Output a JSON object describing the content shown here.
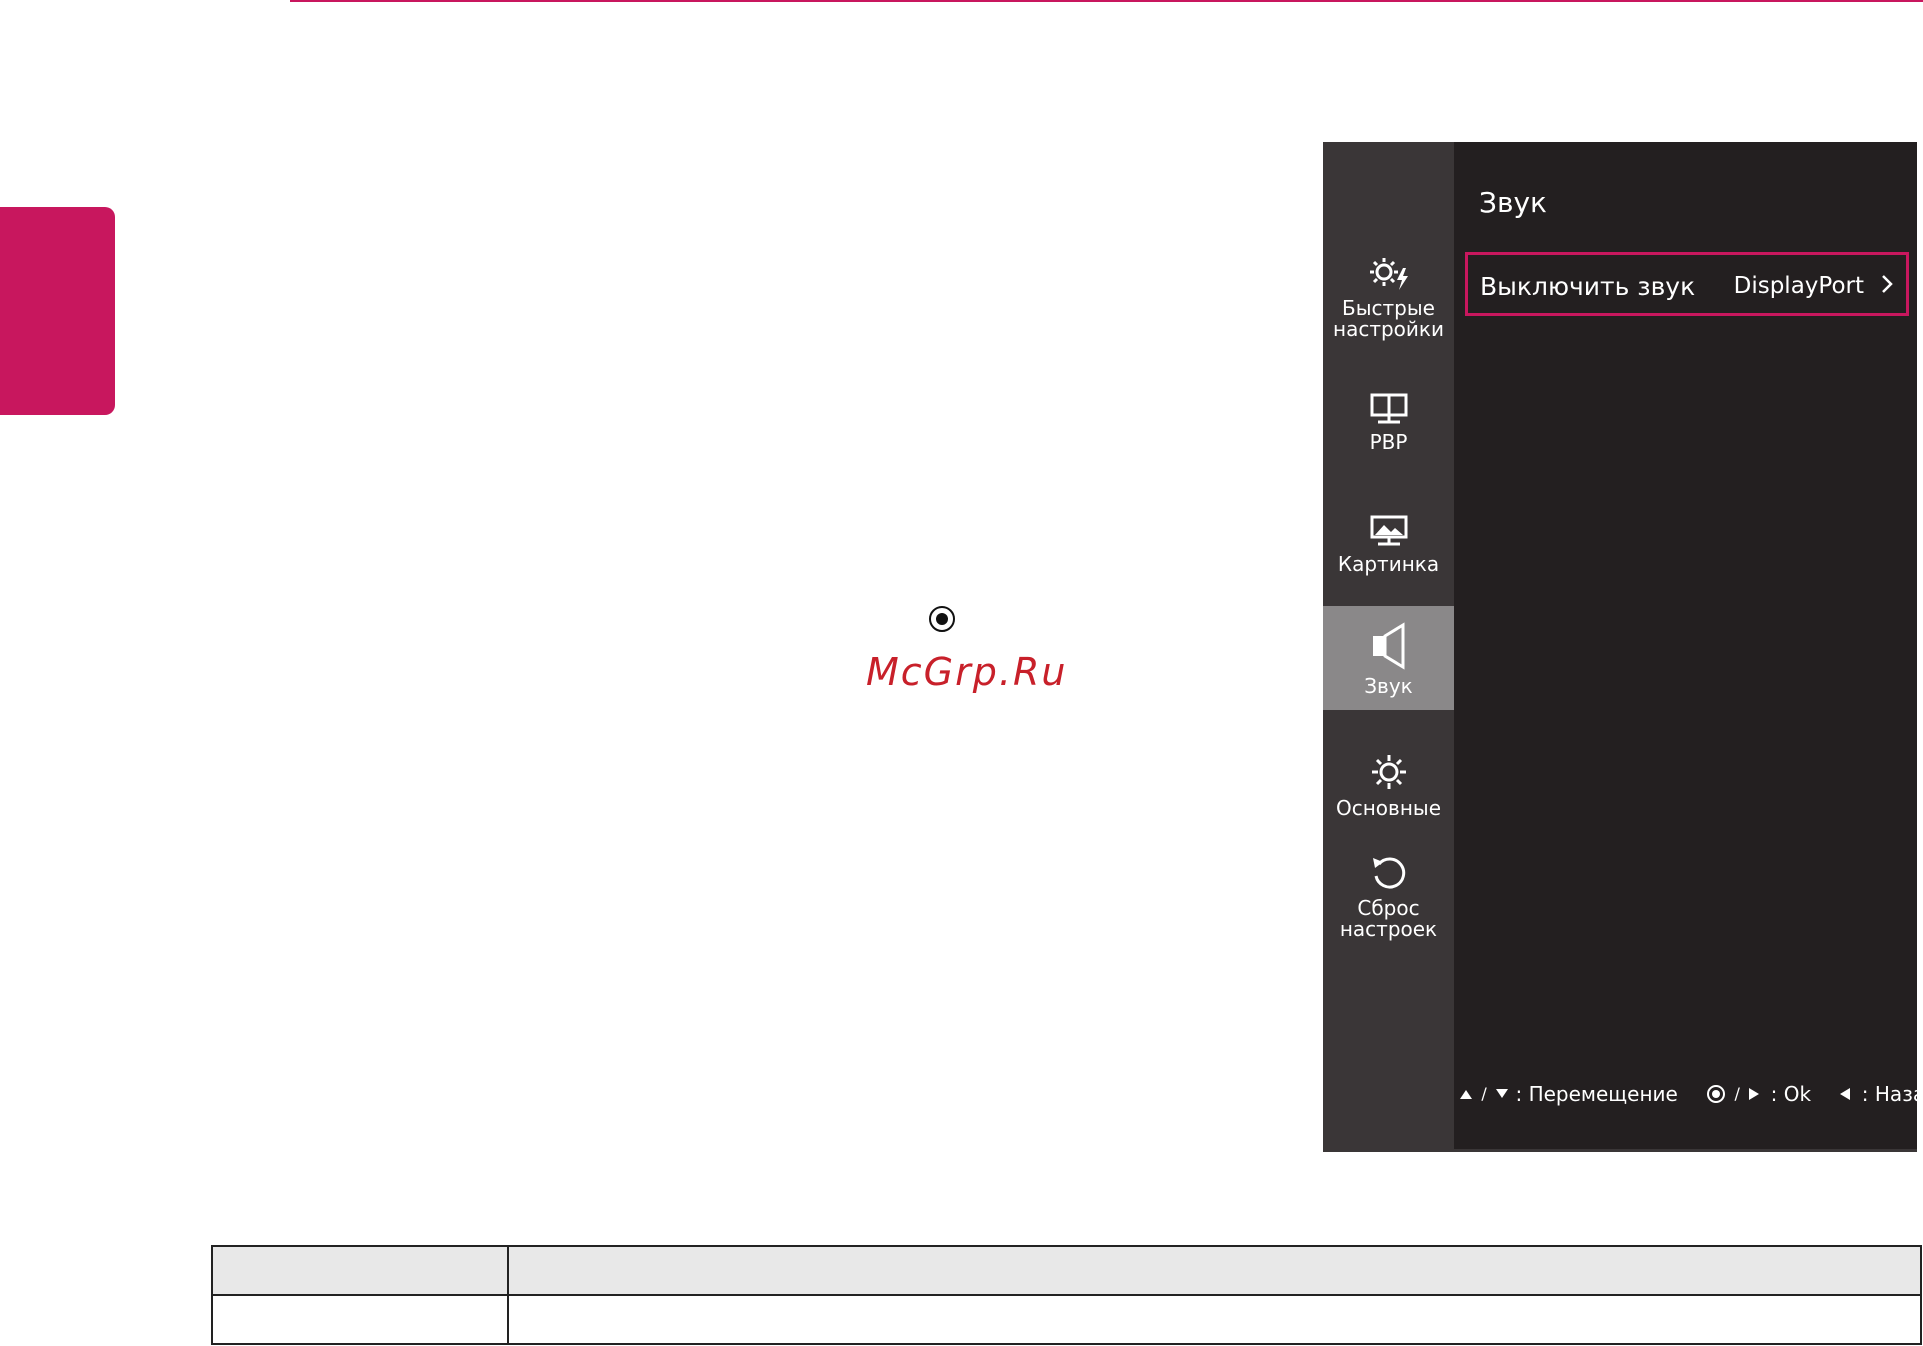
{
  "watermark": "McGrp.Ru",
  "osd": {
    "menu": [
      {
        "id": "quick",
        "label": "Быстрые настройки",
        "icon": "gear-lightning-icon",
        "active": false
      },
      {
        "id": "pbp",
        "label": "PBP",
        "icon": "pbp-screens-icon",
        "active": false
      },
      {
        "id": "picture",
        "label": "Картинка",
        "icon": "picture-icon",
        "active": false
      },
      {
        "id": "sound",
        "label": "Звук",
        "icon": "speaker-icon",
        "active": true
      },
      {
        "id": "general",
        "label": "Основные",
        "icon": "gear-icon",
        "active": false
      },
      {
        "id": "reset",
        "label": "Сброс настроек",
        "icon": "reset-icon",
        "active": false
      }
    ],
    "title": "Звук",
    "option": {
      "label": "Выключить звук",
      "value": "DisplayPort"
    },
    "hints": {
      "move_sep": "/",
      "move_label": ": Перемещение",
      "ok_sep": "/",
      "ok_label": ": Ok",
      "back_label": ": Назад"
    },
    "colors": {
      "accent": "#c8175e",
      "panel": "#231f20",
      "sidebar": "#3a3637",
      "active": "#8a8889"
    }
  },
  "table": {
    "rows": [
      [
        "",
        ""
      ],
      [
        "",
        ""
      ]
    ]
  }
}
